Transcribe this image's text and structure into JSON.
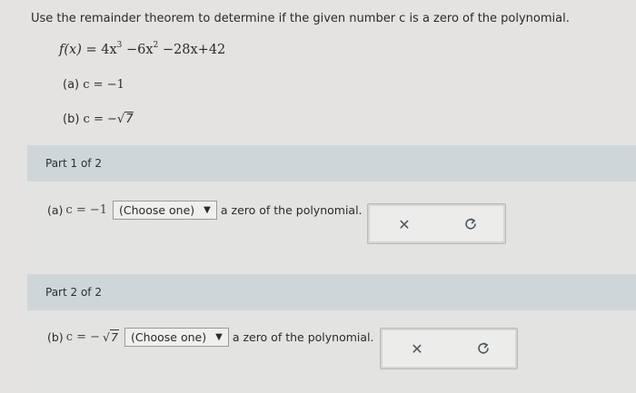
{
  "instruction": "Use the remainder theorem to determine if the given number c is a zero of the polynomial.",
  "polynomial": {
    "lhs": "f(x)",
    "eq": "=",
    "t1": "4x",
    "t1_exp": "3",
    "t2": "−6x",
    "t2_exp": "2",
    "t3": "−28x+42"
  },
  "items": {
    "a_label": "(a)",
    "a_expr": "c = −1",
    "b_label": "(b)",
    "b_expr": "c = −",
    "b_radicand": "7"
  },
  "part1": {
    "header": "Part 1 of 2",
    "prefix_label": "(a)",
    "prefix_expr": "c = −1",
    "select_value": "(Choose one)",
    "suffix": "a zero of the polynomial."
  },
  "part2": {
    "header": "Part 2 of 2",
    "prefix_label": "(b)",
    "prefix_expr": "c = −",
    "radicand": "7",
    "select_value": "(Choose one)",
    "suffix": "a zero of the polynomial."
  },
  "icons": {
    "clear": "close-icon",
    "reset": "undo-icon",
    "dropdown": "caret-down-icon"
  },
  "colors": {
    "part_header_bg": "#cfd6d9",
    "clear_icon": "#4b5761",
    "reset_icon": "#4b5761"
  }
}
